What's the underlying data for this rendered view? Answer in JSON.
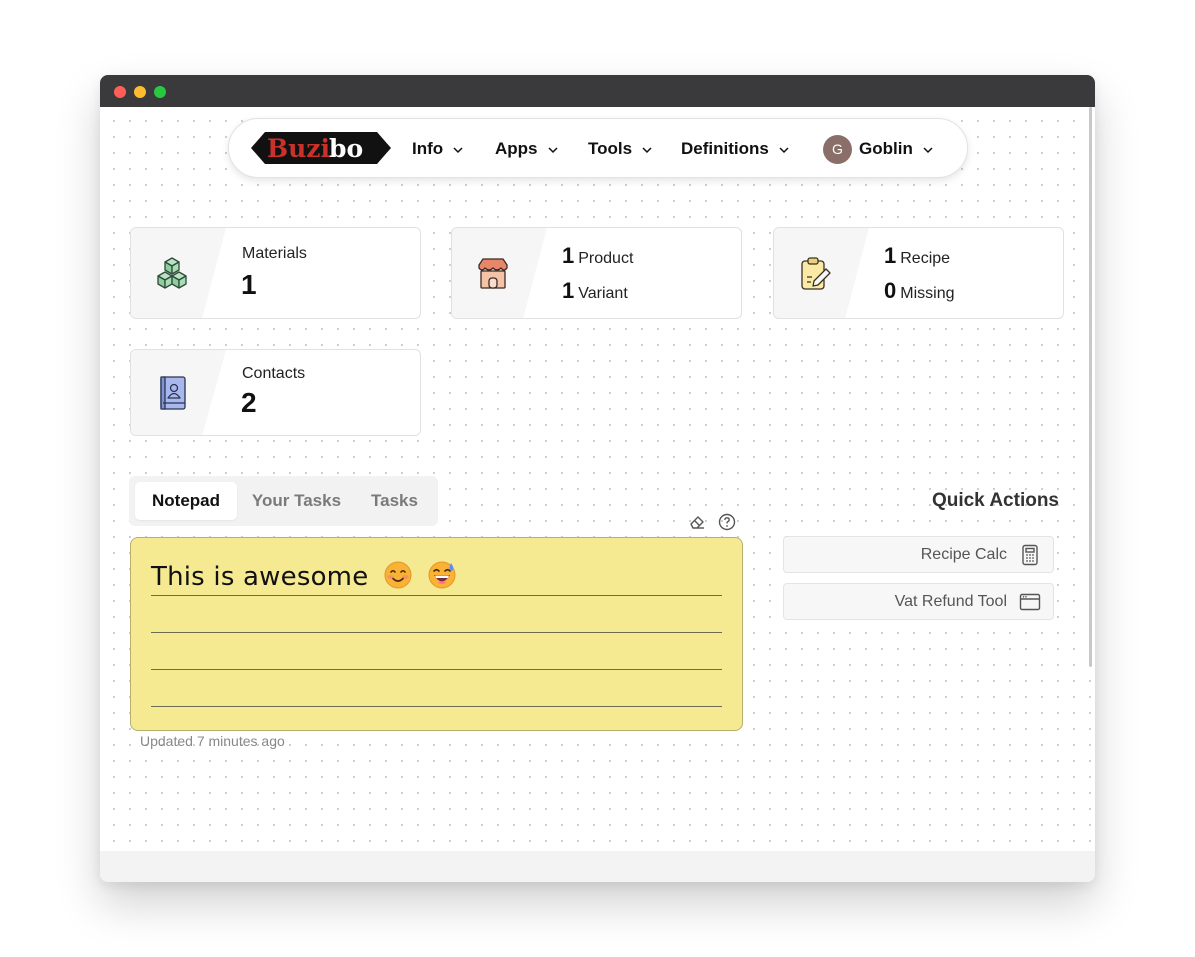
{
  "brand": {
    "logo_text_a": "Buzi",
    "logo_text_b": "bo"
  },
  "nav": {
    "items": [
      {
        "label": "Info"
      },
      {
        "label": "Apps"
      },
      {
        "label": "Tools"
      },
      {
        "label": "Definitions"
      }
    ],
    "user": {
      "initial": "G",
      "name": "Goblin"
    }
  },
  "stats": {
    "materials": {
      "label": "Materials",
      "value": "1"
    },
    "products": {
      "product_count": "1",
      "product_label": "Product",
      "variant_count": "1",
      "variant_label": "Variant"
    },
    "recipes": {
      "recipe_count": "1",
      "recipe_label": "Recipe",
      "missing_count": "0",
      "missing_label": "Missing"
    },
    "contacts": {
      "label": "Contacts",
      "value": "2"
    }
  },
  "tabs": [
    {
      "label": "Notepad",
      "active": true
    },
    {
      "label": "Your Tasks",
      "active": false
    },
    {
      "label": "Tasks",
      "active": false
    }
  ],
  "notepad": {
    "text": "This is awesome",
    "emojis": [
      "smiling-face-icon",
      "grinning-sweat-face-icon"
    ],
    "background": "#f5ea92",
    "updated": "Updated 7 minutes ago"
  },
  "quick_actions": {
    "title": "Quick Actions",
    "items": [
      {
        "label": "Recipe Calc",
        "icon": "calculator-icon"
      },
      {
        "label": "Vat Refund Tool",
        "icon": "browser-window-icon"
      }
    ]
  },
  "colors": {
    "logo_red": "#c8322b",
    "logo_black": "#111111"
  }
}
